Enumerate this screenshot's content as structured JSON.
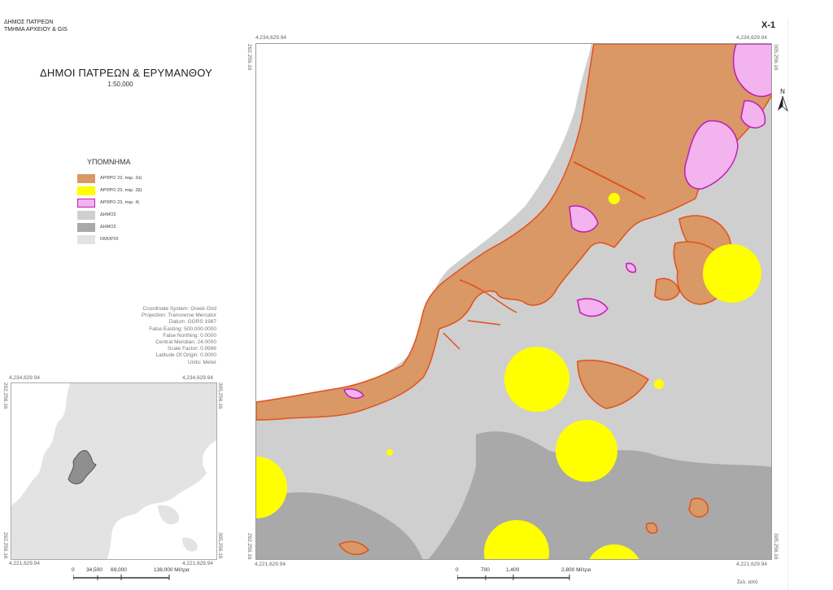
{
  "header": {
    "org_line1": "ΔΗΜΟΣ ΠΑΤΡΕΩΝ",
    "org_line2": "ΤΜΗΜΑ ΑΡΧΕΙΟΥ & GIS",
    "sheet_number": "X-1"
  },
  "map_title": "ΔΗΜΟΙ ΠΑΤΡΕΩΝ & ΕΡΥΜΑΝΘΟΥ",
  "map_scale": "1:50,000",
  "legend": {
    "title": "ΥΠΟΜΝΗΜΑ",
    "items": [
      {
        "label": "ΑΡΘΡΟ 23, παρ. 2α)",
        "color": "#d99866"
      },
      {
        "label": "ΑΡΘΡΟ 23, παρ. 2β)",
        "color": "#ffff00"
      },
      {
        "label": "ΑΡΘΡΟ 23, παρ. 4)",
        "color": "#f2b3ef"
      },
      {
        "label": "ΔΗΜΟΣ",
        "color": "#cfcfcf"
      },
      {
        "label": "ΔΗΜΟΣ",
        "color": "#a9a9a9"
      },
      {
        "label": "ΟΜΟΡΟΙ",
        "color": "#e3e3e3"
      }
    ]
  },
  "crs": {
    "lines": [
      "Coordinate System: Greek Grid",
      "Projection: Transverse Mercator",
      "Datum: GGRS 1987",
      "False Easting: 500,000.0000",
      "False Northing: 0.0000",
      "Central Meridian: 24.0000",
      "Scale Factor: 0.9996",
      "Latitude Of Origin: 0.0000",
      "Units: Meter"
    ]
  },
  "main_frame": {
    "top_left": "4,234,629.94",
    "top_right": "4,234,629.94",
    "bottom_left": "4,221,629.94",
    "bottom_right": "4,221,629.94",
    "left_top": "292,256.16",
    "left_bottom": "292,256.16",
    "right_top": "305,256.16",
    "right_bottom": "305,256.16"
  },
  "inset_frame": {
    "top_left": "4,234,629.94",
    "top_right": "4,234,629.94",
    "bottom_left": "4,221,629.94",
    "bottom_right": "4,221,629.94",
    "left_top": "292,256.16",
    "left_bottom": "292,256.16",
    "right_top": "305,256.16",
    "right_bottom": "305,256.16"
  },
  "north_label": "N",
  "scalebar_inset": {
    "ticks": [
      "0",
      "34,500",
      "69,000",
      "138,000 Μέτρα"
    ]
  },
  "scalebar_main": {
    "ticks": [
      "0",
      "700",
      "1,400",
      "2,800 Μέτρα"
    ]
  },
  "colors": {
    "land": "#cfcfcf",
    "land_dark": "#a9a9a9",
    "sea": "#ffffff",
    "orange_zone": "#d99866",
    "orange_outline": "#e0521c",
    "yellow_zone": "#ffff00",
    "pink_zone": "#f2b3ef",
    "pink_outline": "#c21cb5"
  },
  "footer": {
    "page": "Σελ.  από"
  }
}
